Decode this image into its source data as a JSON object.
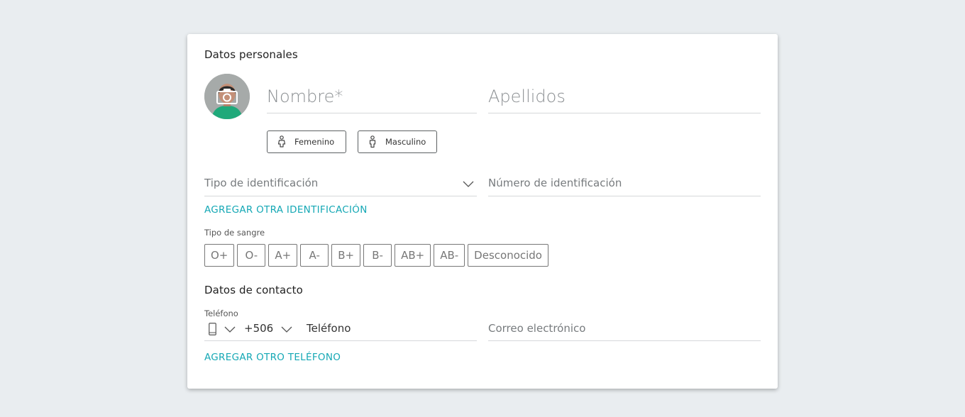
{
  "personal": {
    "title": "Datos personales",
    "avatar_icon": "camera-icon",
    "first_name_placeholder": "Nombre*",
    "last_name_placeholder": "Apellidos",
    "gender_female": "Femenino",
    "gender_male": "Masculino",
    "id_type_placeholder": "Tipo de identificación",
    "id_number_placeholder": "Número de identificación",
    "add_id_link": "AGREGAR OTRA IDENTIFICACIÓN",
    "blood_label": "Tipo de sangre",
    "blood_types": [
      "O+",
      "O-",
      "A+",
      "A-",
      "B+",
      "B-",
      "AB+",
      "AB-",
      "Desconocido"
    ]
  },
  "contact": {
    "title": "Datos de contacto",
    "phone_label": "Teléfono",
    "phone_type_icon": "mobile-phone-icon",
    "country_code": "+506",
    "phone_placeholder": "Teléfono",
    "email_placeholder": "Correo electrónico",
    "add_phone_link": "AGREGAR OTRO TELÉFONO"
  },
  "colors": {
    "accent": "#15a8b5",
    "background": "#e9edf0",
    "avatar_shirt": "#1fa97a"
  }
}
